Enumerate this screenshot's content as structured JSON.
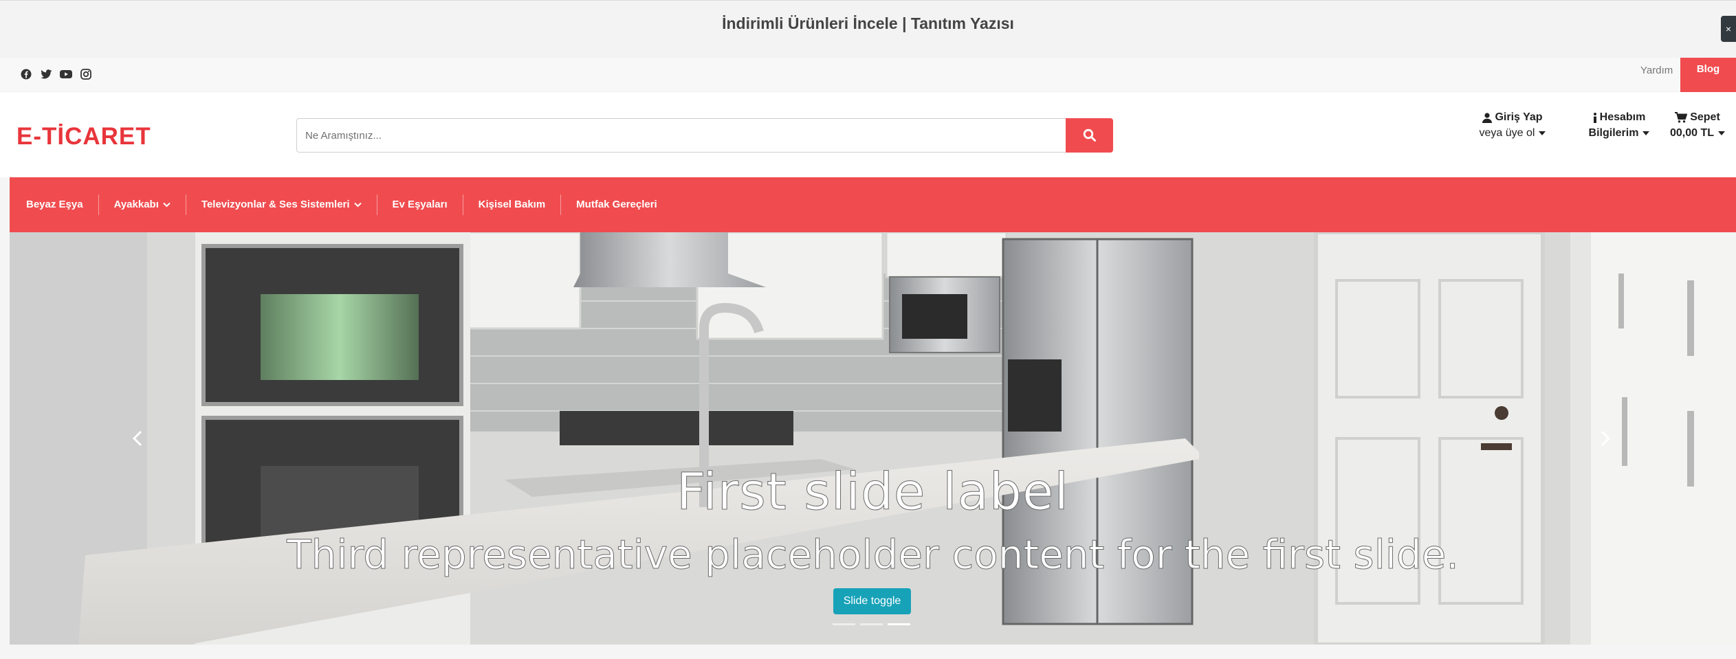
{
  "promo": {
    "text": "İndirimli Ürünleri İncele | Tanıtım Yazısı",
    "close": "×"
  },
  "topbar": {
    "social_icons": [
      "facebook-icon",
      "twitter-icon",
      "youtube-icon",
      "instagram-icon"
    ],
    "help_label": "Yardım",
    "blog_label": "Blog"
  },
  "header": {
    "logo": "E-TİCARET",
    "search": {
      "placeholder": "Ne Aramıştınız...",
      "value": ""
    },
    "login": {
      "title": "Giriş Yap",
      "sub": "veya üye ol"
    },
    "account": {
      "title": "Hesabım",
      "sub": "Bilgilerim"
    },
    "cart": {
      "title": "Sepet",
      "total": "00,00 TL"
    }
  },
  "nav": {
    "items": [
      {
        "label": "Beyaz Eşya",
        "has_dropdown": false
      },
      {
        "label": "Ayakkabı",
        "has_dropdown": true
      },
      {
        "label": "Televizyonlar & Ses Sistemleri",
        "has_dropdown": true
      },
      {
        "label": "Ev Eşyaları",
        "has_dropdown": false
      },
      {
        "label": "Kişisel Bakım",
        "has_dropdown": false
      },
      {
        "label": "Mutfak Gereçleri",
        "has_dropdown": false
      }
    ]
  },
  "carousel": {
    "title": "First slide label",
    "text": "Third representative placeholder content for the first slide.",
    "button": "Slide toggle",
    "slide_count": 3,
    "active_slide": 3
  },
  "colors": {
    "accent": "#f04c4f",
    "logo": "#e8353b",
    "button_info": "#17a2b8"
  }
}
